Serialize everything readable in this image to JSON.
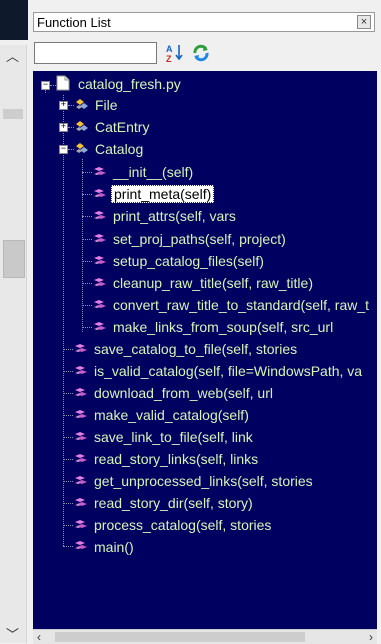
{
  "panel": {
    "title": "Function List",
    "close_label": "×",
    "search": {
      "value": "",
      "placeholder": ""
    }
  },
  "tree": {
    "file": "catalog_fresh.py",
    "classes": [
      {
        "name": "File",
        "expanded": false
      },
      {
        "name": "CatEntry",
        "expanded": false
      },
      {
        "name": "Catalog",
        "expanded": true
      }
    ],
    "catalog_methods": [
      "__init__(self)",
      "print_meta(self)",
      "print_attrs(self, vars",
      "set_proj_paths(self, project)",
      "setup_catalog_files(self)",
      "cleanup_raw_title(self, raw_title)",
      "convert_raw_title_to_standard(self, raw_t",
      "make_links_from_soup(self, src_url"
    ],
    "selected": "print_meta(self)",
    "functions": [
      "save_catalog_to_file(self, stories",
      "is_valid_catalog(self, file=WindowsPath, va",
      "download_from_web(self, url",
      "make_valid_catalog(self)",
      "save_link_to_file(self, link",
      "read_story_links(self, links",
      "get_unprocessed_links(self, stories",
      "read_story_dir(self, story)",
      "process_catalog(self, stories",
      "main()"
    ]
  },
  "colors": {
    "tree_background": "#000060",
    "tree_text": "#d6f5b8",
    "selected_background": "#ffffff"
  }
}
